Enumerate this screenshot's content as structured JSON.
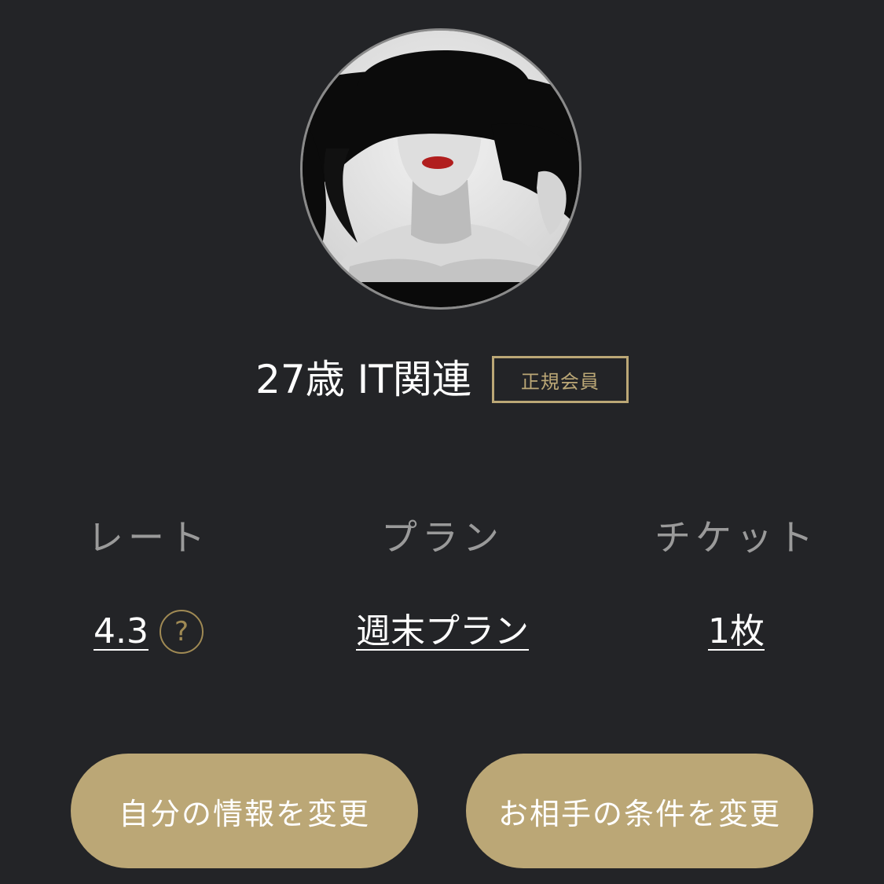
{
  "profile": {
    "name": "27歳 IT関連",
    "badge": "正規会員"
  },
  "stats": {
    "rate": {
      "label": "レート",
      "value": "4.3",
      "help_icon": "?"
    },
    "plan": {
      "label": "プラン",
      "value": "週末プラン"
    },
    "ticket": {
      "label": "チケット",
      "value": "1枚"
    }
  },
  "buttons": {
    "edit_self": "自分の情報を変更",
    "edit_partner": "お相手の条件を変更"
  },
  "colors": {
    "background": "#232427",
    "accent_gold": "#bba776",
    "label_gray": "#9a9a9a"
  }
}
